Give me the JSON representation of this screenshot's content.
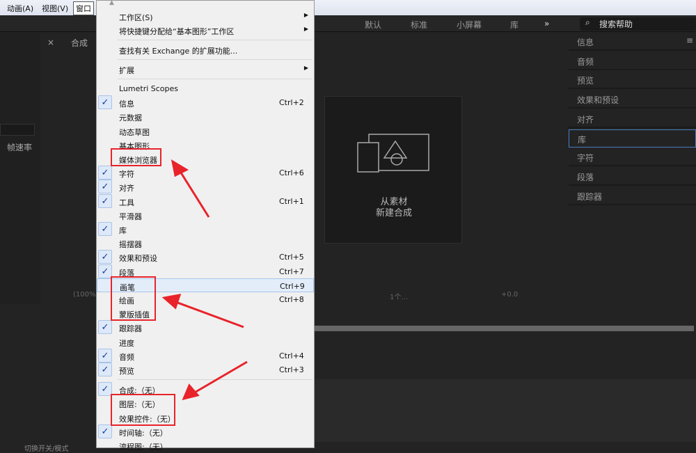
{
  "menubar": {
    "items": [
      "动画(A)",
      "视图(V)",
      "窗口"
    ]
  },
  "workspaces": [
    "默认",
    "标准",
    "小屏幕",
    "库",
    "»"
  ],
  "search": {
    "placeholder": "搜索帮助"
  },
  "left": {
    "comp_tab": "合成",
    "framerate": "帧速率",
    "zoom": "(100%)",
    "toggle": "切换开关/模式"
  },
  "viewer": {
    "count": "1个...",
    "exposure": "+0.0"
  },
  "new_comp": {
    "line1": "从素材",
    "line2": "新建合成"
  },
  "right_panels": [
    "信息",
    "音频",
    "预览",
    "效果和预设",
    "对齐",
    "库",
    "字符",
    "段落",
    "跟踪器"
  ],
  "menu": {
    "top": [
      {
        "label": "工作区(S)",
        "submenu": true
      },
      {
        "label": "将快捷键分配给“基本图形”工作区",
        "submenu": true
      }
    ],
    "exchange": "查找有关 Exchange 的扩展功能...",
    "extensions": "扩展",
    "items": [
      {
        "label": "Lumetri Scopes",
        "checked": false,
        "shortcut": ""
      },
      {
        "label": "信息",
        "checked": true,
        "shortcut": "Ctrl+2"
      },
      {
        "label": "元数据",
        "checked": false,
        "shortcut": ""
      },
      {
        "label": "动态草图",
        "checked": false,
        "shortcut": ""
      },
      {
        "label": "基本图形",
        "checked": false,
        "shortcut": ""
      },
      {
        "label": "媒体浏览器",
        "checked": false,
        "shortcut": ""
      },
      {
        "label": "字符",
        "checked": true,
        "shortcut": "Ctrl+6"
      },
      {
        "label": "对齐",
        "checked": true,
        "shortcut": ""
      },
      {
        "label": "工具",
        "checked": true,
        "shortcut": "Ctrl+1"
      },
      {
        "label": "平滑器",
        "checked": false,
        "shortcut": ""
      },
      {
        "label": "库",
        "checked": true,
        "shortcut": ""
      },
      {
        "label": "摇摆器",
        "checked": false,
        "shortcut": ""
      },
      {
        "label": "效果和预设",
        "checked": true,
        "shortcut": "Ctrl+5"
      },
      {
        "label": "段落",
        "checked": true,
        "shortcut": "Ctrl+7"
      },
      {
        "label": "画笔",
        "checked": false,
        "shortcut": "Ctrl+9",
        "highlighted": true
      },
      {
        "label": "绘画",
        "checked": false,
        "shortcut": "Ctrl+8"
      },
      {
        "label": "蒙版插值",
        "checked": false,
        "shortcut": ""
      },
      {
        "label": "跟踪器",
        "checked": true,
        "shortcut": ""
      },
      {
        "label": "进度",
        "checked": false,
        "shortcut": ""
      },
      {
        "label": "音频",
        "checked": true,
        "shortcut": "Ctrl+4"
      },
      {
        "label": "预览",
        "checked": true,
        "shortcut": "Ctrl+3"
      }
    ],
    "panels": [
      {
        "label": "合成:（无）",
        "checked": true
      },
      {
        "label": "图层:（无）",
        "checked": false
      },
      {
        "label": "效果控件:（无）",
        "checked": false
      },
      {
        "label": "时间轴:（无）",
        "checked": true
      },
      {
        "label": "流程图:（无）",
        "checked": false
      }
    ]
  },
  "colors": {
    "annotation": "#e8232a",
    "check": "#1a3a9a"
  }
}
